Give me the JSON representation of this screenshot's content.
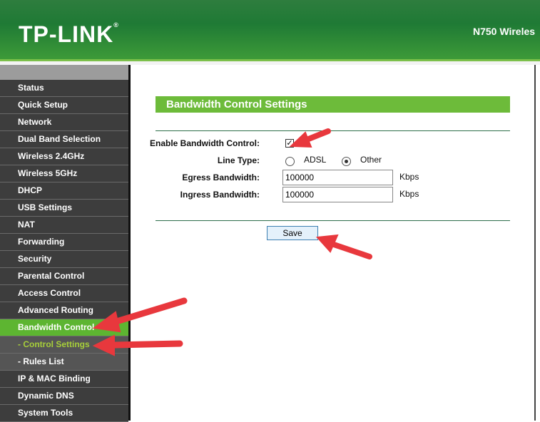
{
  "header": {
    "logo": "TP-LINK",
    "model": "N750 Wireles"
  },
  "sidebar": {
    "items": [
      {
        "label": "Status"
      },
      {
        "label": "Quick Setup"
      },
      {
        "label": "Network"
      },
      {
        "label": "Dual Band Selection"
      },
      {
        "label": "Wireless 2.4GHz"
      },
      {
        "label": "Wireless 5GHz"
      },
      {
        "label": "DHCP"
      },
      {
        "label": "USB Settings"
      },
      {
        "label": "NAT"
      },
      {
        "label": "Forwarding"
      },
      {
        "label": "Security"
      },
      {
        "label": "Parental Control"
      },
      {
        "label": "Access Control"
      },
      {
        "label": "Advanced Routing"
      },
      {
        "label": "Bandwidth Control"
      },
      {
        "label": "- Control Settings"
      },
      {
        "label": "- Rules List"
      },
      {
        "label": "IP & MAC Binding"
      },
      {
        "label": "Dynamic DNS"
      },
      {
        "label": "System Tools"
      }
    ]
  },
  "main": {
    "title": "Bandwidth Control Settings",
    "enable_label": "Enable Bandwidth Control:",
    "enable_checked": true,
    "line_type_label": "Line Type:",
    "adsl": "ADSL",
    "other": "Other",
    "selected_line_type": "Other",
    "egress_label": "Egress Bandwidth:",
    "egress_value": "100000",
    "ingress_label": "Ingress Bandwidth:",
    "ingress_value": "100000",
    "unit": "Kbps",
    "save": "Save"
  },
  "colors": {
    "brand_green": "#1f7a35",
    "active_green": "#5db531",
    "arrow_red": "#e8383d"
  }
}
